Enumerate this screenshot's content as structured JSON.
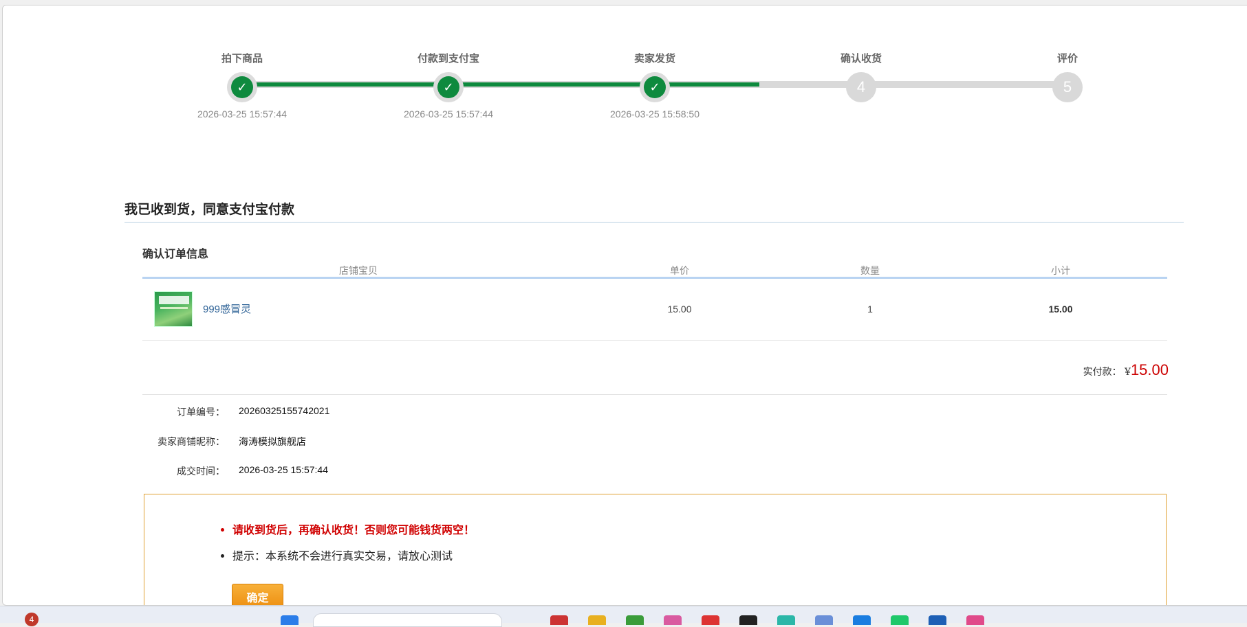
{
  "steps": [
    {
      "label": "拍下商品",
      "status": "done",
      "time": "2026-03-25 15:57:44"
    },
    {
      "label": "付款到支付宝",
      "status": "done",
      "time": "2026-03-25 15:57:44"
    },
    {
      "label": "卖家发货",
      "status": "done",
      "time": "2026-03-25 15:58:50"
    },
    {
      "label": "确认收货",
      "status": "todo",
      "number": "4",
      "time": ""
    },
    {
      "label": "评价",
      "status": "todo",
      "number": "5",
      "time": ""
    }
  ],
  "page_title": "我已收到货，同意支付宝付款",
  "order_section": {
    "title": "确认订单信息",
    "columns": [
      "店铺宝贝",
      "单价",
      "数量",
      "小计"
    ],
    "items": [
      {
        "name": "999感冒灵",
        "unit_price": "15.00",
        "quantity": "1",
        "subtotal": "15.00"
      }
    ],
    "paid_label": "实付款：",
    "currency": "¥",
    "paid_amount": "15.00"
  },
  "order_info": [
    {
      "key": "订单编号：",
      "value": "20260325155742021"
    },
    {
      "key": "卖家商铺昵称：",
      "value": "海涛模拟旗舰店"
    },
    {
      "key": "成交时间：",
      "value": "2026-03-25 15:57:44"
    }
  ],
  "notice": {
    "warning": "请收到货后，再确认收货！否则您可能钱货两空！",
    "tip": "提示：本系统不会进行真实交易，请放心测试",
    "confirm_label": "确定"
  },
  "taskbar": {
    "badge_count": "4"
  },
  "colors": {
    "progress_done": "#0e8a3e",
    "progress_todo": "#d9d9d9",
    "price_red": "#cc0000",
    "button_orange": "#f0a020",
    "link_blue": "#336699"
  }
}
